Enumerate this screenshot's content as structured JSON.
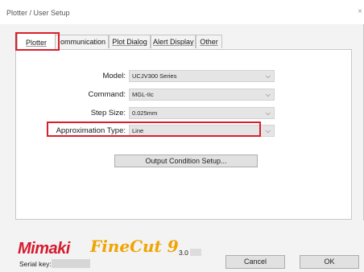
{
  "window": {
    "title": "Plotter / User Setup",
    "close_glyph": "×"
  },
  "tabs": [
    {
      "label": "Plotter",
      "active": true
    },
    {
      "label": "Communication",
      "visible_text": "ommunication"
    },
    {
      "label": "Plot Dialog"
    },
    {
      "label": "Alert Display"
    },
    {
      "label": "Other"
    }
  ],
  "fields": {
    "model": {
      "label": "Model:",
      "value": "UCJV300 Series"
    },
    "command": {
      "label": "Command:",
      "value": "MGL-IIc"
    },
    "step_size": {
      "label": "Step Size:",
      "value": "0.025mm"
    },
    "approximation_type": {
      "label": "Approximation Type:",
      "value": "Line"
    }
  },
  "output_button": "Output Condition Setup...",
  "footer": {
    "brand_mimaki": "Mimaki",
    "brand_finecut": "FineCut 9",
    "version_prefix": "3.0",
    "serial_label": "Serial key:",
    "cancel_label": "Cancel",
    "ok_label": "OK"
  },
  "colors": {
    "highlight": "#d9202a",
    "mimaki_red": "#d61a2e",
    "finecut_orange": "#f0a400"
  },
  "icons": {
    "combo_chevron": "chevron-down-icon",
    "close": "close-icon"
  }
}
